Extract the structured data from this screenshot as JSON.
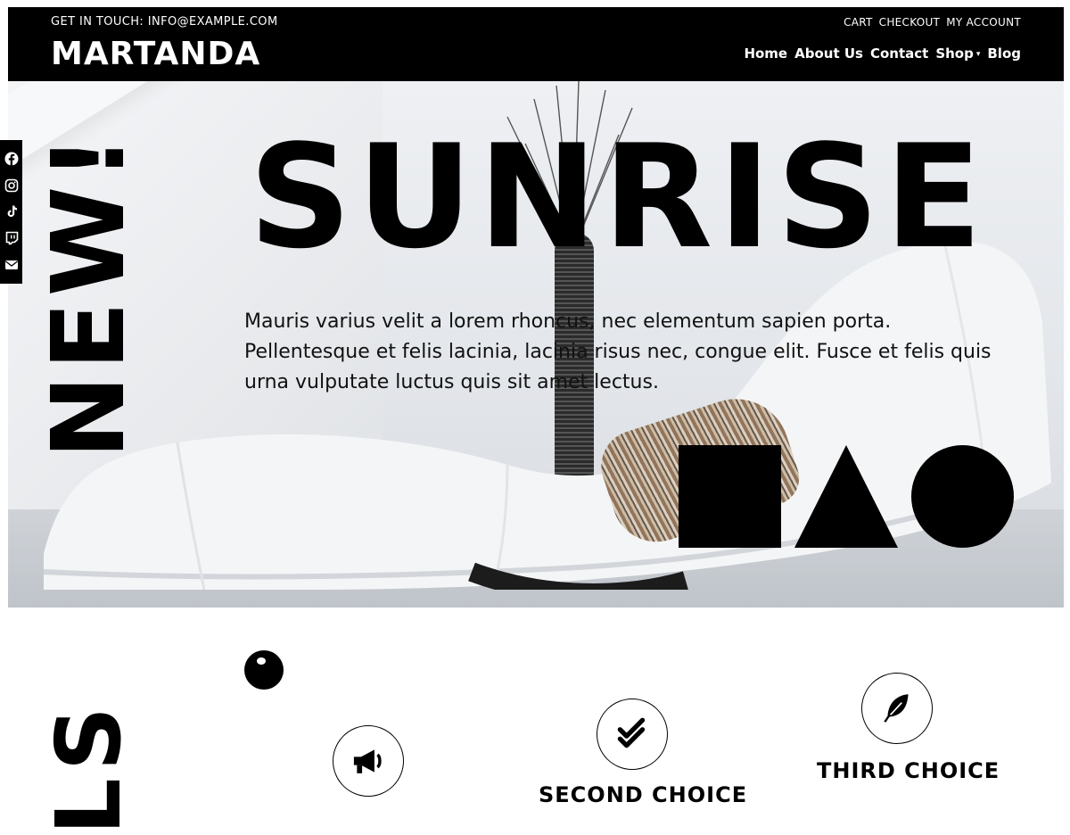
{
  "header": {
    "contact_text": "GET IN TOUCH: INFO@EXAMPLE.COM",
    "logo": "MARTANDA",
    "util_nav": [
      "CART",
      "CHECKOUT",
      "MY ACCOUNT"
    ],
    "main_nav": [
      "Home",
      "About Us",
      "Contact",
      "Shop",
      "Blog"
    ]
  },
  "hero": {
    "title": "SUNRISE",
    "description": "Mauris varius velit a lorem rhoncus, nec elementum sapien porta. Pellentesque et felis lacinia, lacinia risus nec, congue elit. Fusce et felis quis urna vulputate luctus quis sit amet lectus.",
    "vertical_label": "NEW!"
  },
  "social": {
    "icons": [
      "facebook-icon",
      "instagram-icon",
      "tiktok-icon",
      "twitch-icon",
      "email-icon"
    ]
  },
  "features": {
    "vertical_label": "LS",
    "items": [
      {
        "icon": "megaphone-icon",
        "title": ""
      },
      {
        "icon": "checkmark-icon",
        "title": "SECOND CHOICE"
      },
      {
        "icon": "feather-icon",
        "title": "THIRD CHOICE"
      }
    ]
  },
  "colors": {
    "header_bg": "#000000",
    "text": "#000000",
    "accent": "#ffffff"
  }
}
